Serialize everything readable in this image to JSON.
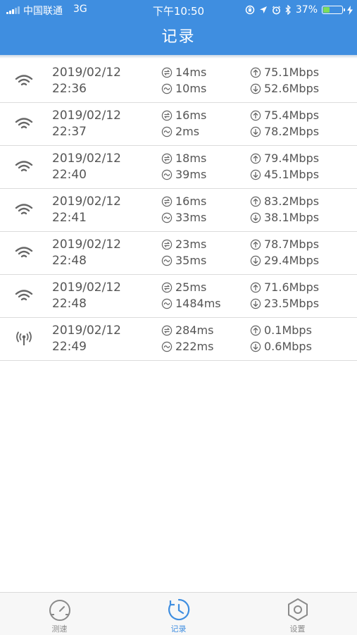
{
  "status_bar": {
    "carrier": "中国联通",
    "network": "3G",
    "time": "下午10:50",
    "battery": "37%",
    "battery_level": 0.37
  },
  "header": {
    "title": "记录"
  },
  "records": [
    {
      "date": "2019/02/12",
      "time": "22:36",
      "ping": "14ms",
      "jitter": "10ms",
      "upload": "75.1Mbps",
      "download": "52.6Mbps",
      "connection": "wifi-icon"
    },
    {
      "date": "2019/02/12",
      "time": "22:37",
      "ping": "16ms",
      "jitter": "2ms",
      "upload": "75.4Mbps",
      "download": "78.2Mbps",
      "connection": "wifi-icon"
    },
    {
      "date": "2019/02/12",
      "time": "22:40",
      "ping": "18ms",
      "jitter": "39ms",
      "upload": "79.4Mbps",
      "download": "45.1Mbps",
      "connection": "wifi-icon"
    },
    {
      "date": "2019/02/12",
      "time": "22:41",
      "ping": "16ms",
      "jitter": "33ms",
      "upload": "83.2Mbps",
      "download": "38.1Mbps",
      "connection": "wifi-icon"
    },
    {
      "date": "2019/02/12",
      "time": "22:48",
      "ping": "23ms",
      "jitter": "35ms",
      "upload": "78.7Mbps",
      "download": "29.4Mbps",
      "connection": "wifi-icon"
    },
    {
      "date": "2019/02/12",
      "time": "22:48",
      "ping": "25ms",
      "jitter": "1484ms",
      "upload": "71.6Mbps",
      "download": "23.5Mbps",
      "connection": "wifi-icon"
    },
    {
      "date": "2019/02/12",
      "time": "22:49",
      "ping": "284ms",
      "jitter": "222ms",
      "upload": "0.1Mbps",
      "download": "0.6Mbps",
      "connection": "cellular-icon"
    }
  ],
  "tabbar": {
    "tabs": [
      {
        "label": "测速",
        "icon": "speedometer-icon",
        "active": false
      },
      {
        "label": "记录",
        "icon": "clock-history-icon",
        "active": true
      },
      {
        "label": "设置",
        "icon": "hexagon-settings-icon",
        "active": false
      }
    ]
  },
  "colors": {
    "accent": "#3f8ee0",
    "text": "#555555",
    "icon": "#666666",
    "tab_inactive": "#8a8a8a",
    "divider": "#dcdcdc",
    "battery_fill": "#7ddc5a"
  }
}
